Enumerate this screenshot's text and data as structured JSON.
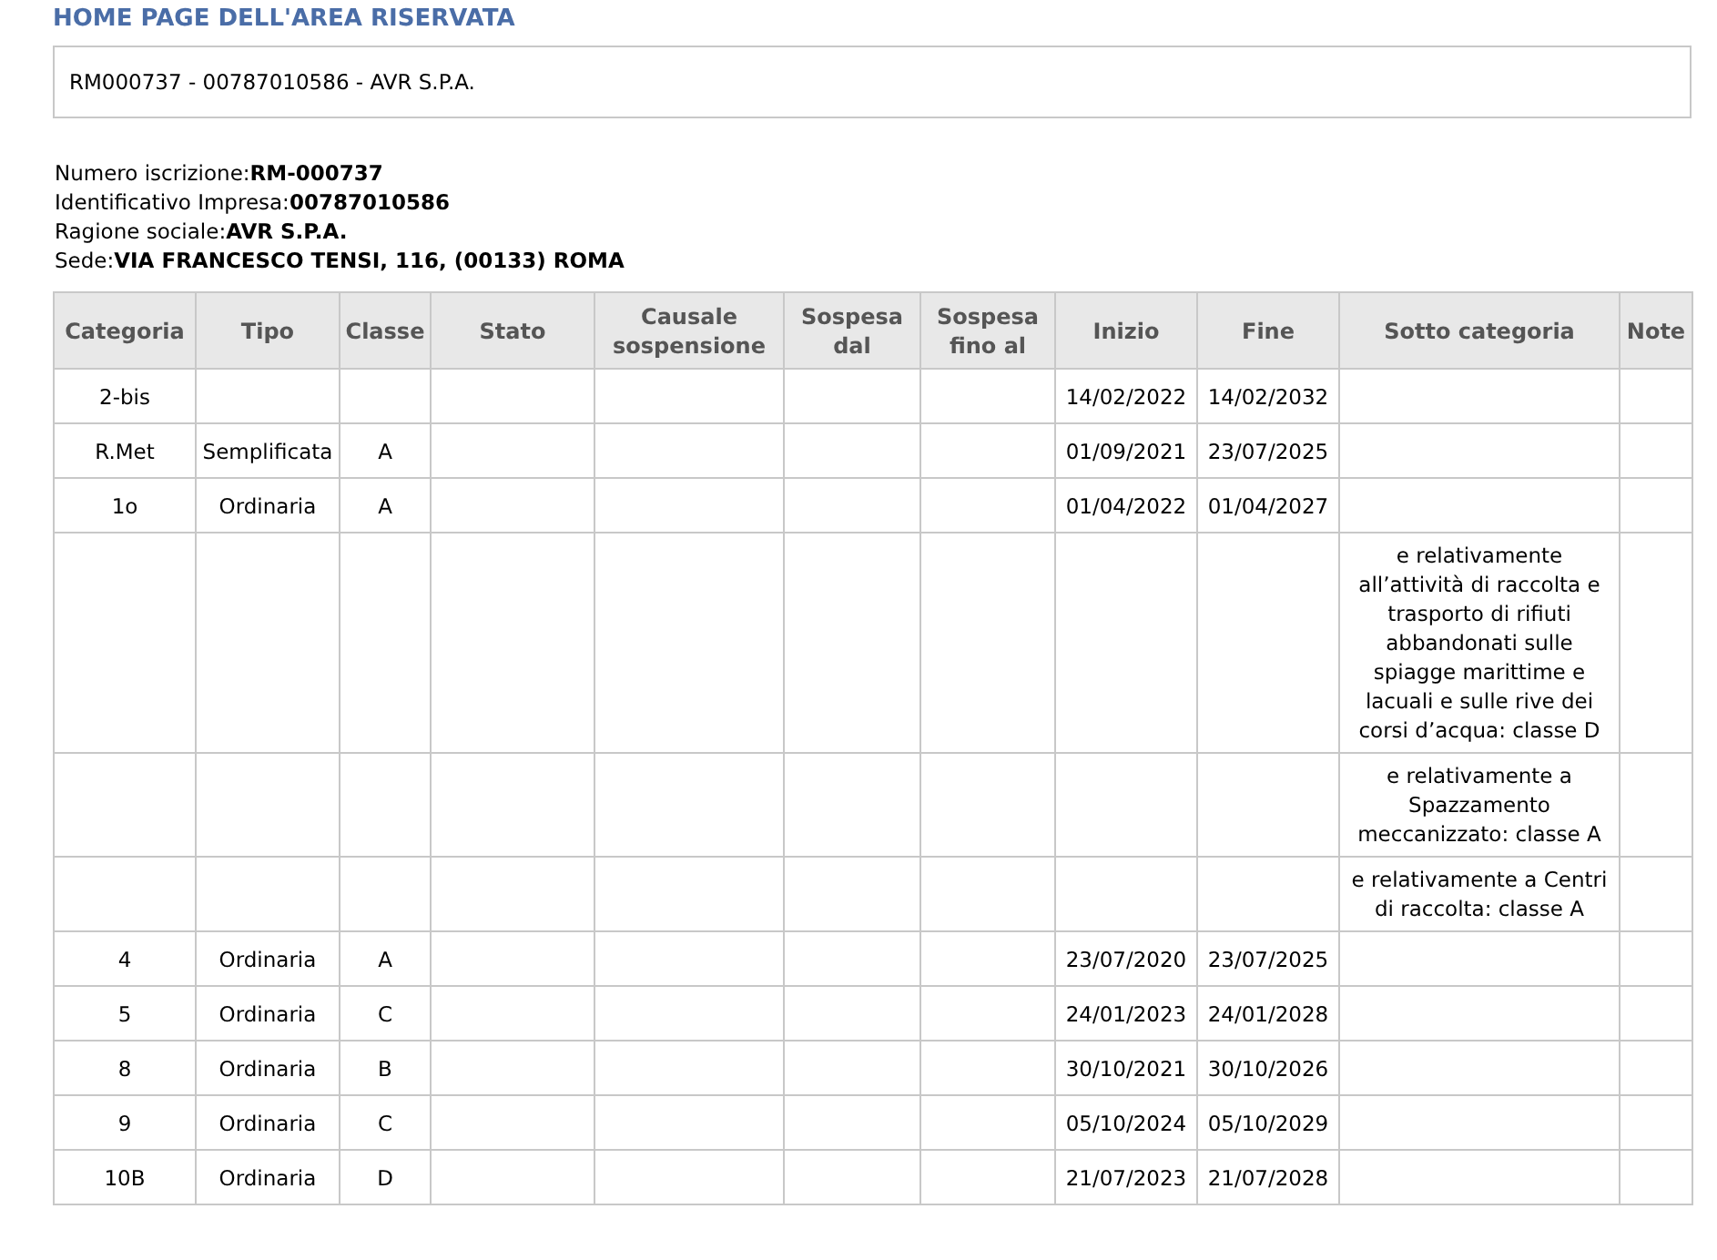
{
  "page_title": "HOME PAGE DELL'AREA RISERVATA",
  "selector": {
    "value": "RM000737 - 00787010586 - AVR S.P.A."
  },
  "details": [
    {
      "label": "Numero iscrizione:",
      "value": "RM-000737"
    },
    {
      "label": "Identificativo Impresa:",
      "value": "00787010586"
    },
    {
      "label": "Ragione sociale:",
      "value": "AVR S.P.A."
    },
    {
      "label": "Sede:",
      "value": "VIA FRANCESCO TENSI, 116, (00133) ROMA"
    }
  ],
  "table": {
    "columns": [
      {
        "label": "Categoria"
      },
      {
        "label": "Tipo"
      },
      {
        "label": "Classe"
      },
      {
        "label": "Stato"
      },
      {
        "label": "Causale sospensione"
      },
      {
        "label": "Sospesa dal"
      },
      {
        "label": "Sospesa fino al"
      },
      {
        "label": "Inizio"
      },
      {
        "label": "Fine"
      },
      {
        "label": "Sotto categoria"
      },
      {
        "label": "Note"
      }
    ],
    "rows": [
      {
        "categoria": "2-bis",
        "inizio": "14/02/2022",
        "fine": "14/02/2032"
      },
      {
        "categoria": "R.Met",
        "tipo": "Semplificata",
        "classe": "A",
        "inizio": "01/09/2021",
        "fine": "23/07/2025"
      },
      {
        "categoria": "1o",
        "tipo": "Ordinaria",
        "classe": "A",
        "inizio": "01/04/2022",
        "fine": "01/04/2027"
      },
      {
        "sotto_categoria": "e relativamente all’attività di raccolta e trasporto di rifiuti abbandonati sulle spiagge marittime e lacuali e sulle rive dei corsi d’acqua: classe D"
      },
      {
        "sotto_categoria": "e relativamente a Spazzamento meccanizzato: classe A"
      },
      {
        "sotto_categoria": "e relativamente a Centri di raccolta: classe A"
      },
      {
        "categoria": "4",
        "tipo": "Ordinaria",
        "classe": "A",
        "inizio": "23/07/2020",
        "fine": "23/07/2025"
      },
      {
        "categoria": "5",
        "tipo": "Ordinaria",
        "classe": "C",
        "inizio": "24/01/2023",
        "fine": "24/01/2028"
      },
      {
        "categoria": "8",
        "tipo": "Ordinaria",
        "classe": "B",
        "inizio": "30/10/2021",
        "fine": "30/10/2026"
      },
      {
        "categoria": "9",
        "tipo": "Ordinaria",
        "classe": "C",
        "inizio": "05/10/2024",
        "fine": "05/10/2029"
      },
      {
        "categoria": "10B",
        "tipo": "Ordinaria",
        "classe": "D",
        "inizio": "21/07/2023",
        "fine": "21/07/2028"
      }
    ]
  }
}
